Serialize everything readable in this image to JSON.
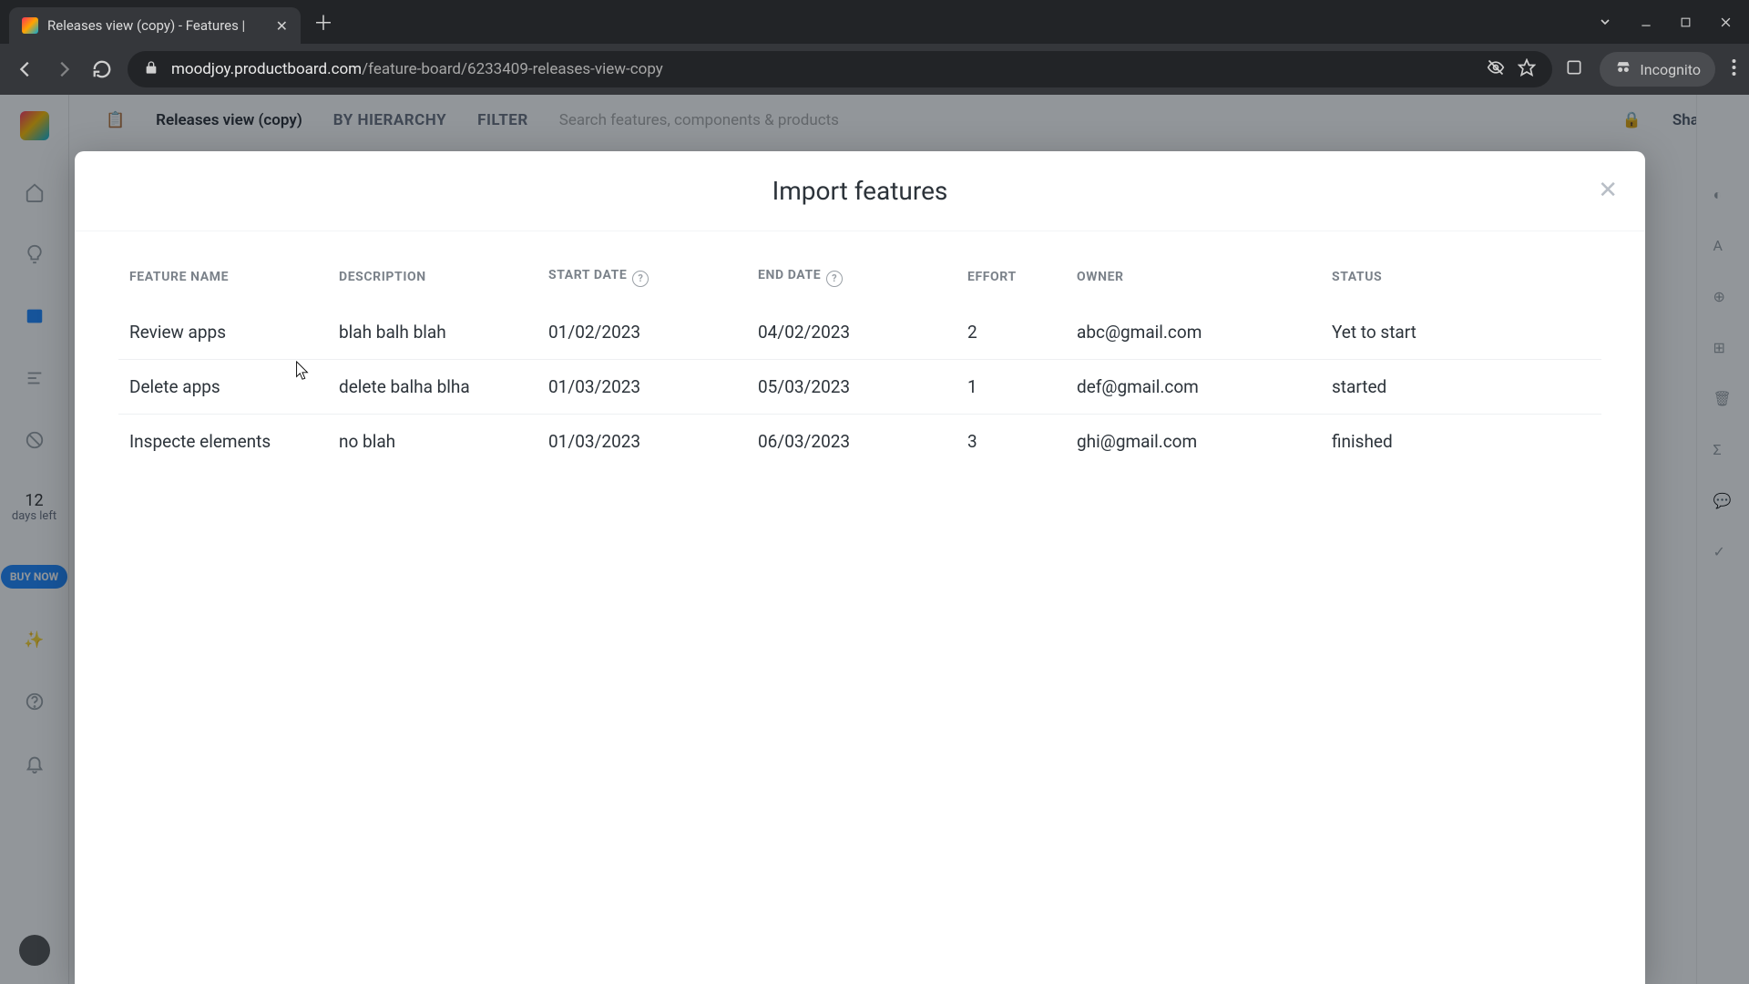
{
  "browser": {
    "tab_title": "Releases view (copy) - Features |",
    "url_host": "moodjoy.productboard.com",
    "url_path": "/feature-board/6233409-releases-view-copy",
    "incognito_label": "Incognito"
  },
  "app": {
    "view_name": "Releases view (copy)",
    "by_hierarchy": "BY HIERARCHY",
    "filter": "FILTER",
    "search_placeholder": "Search features, components & products",
    "share": "Share",
    "days_left_n": "12",
    "days_left_label": "days left",
    "buy_now": "BUY NOW"
  },
  "modal": {
    "title": "Import features",
    "headers": {
      "feature_name": "FEATURE NAME",
      "description": "DESCRIPTION",
      "start_date": "START DATE",
      "end_date": "END DATE",
      "effort": "EFFORT",
      "owner": "OWNER",
      "status": "STATUS"
    },
    "rows": [
      {
        "name": "Review apps",
        "desc": "blah balh blah",
        "start": "01/02/2023",
        "end": "04/02/2023",
        "effort": "2",
        "owner": "abc@gmail.com",
        "status": "Yet to start"
      },
      {
        "name": "Delete apps",
        "desc": "delete balha blha",
        "start": "01/03/2023",
        "end": "05/03/2023",
        "effort": "1",
        "owner": "def@gmail.com",
        "status": "started"
      },
      {
        "name": "Inspecte elements",
        "desc": "no blah",
        "start": "01/03/2023",
        "end": "06/03/2023",
        "effort": "3",
        "owner": "ghi@gmail.com",
        "status": "finished"
      }
    ]
  }
}
